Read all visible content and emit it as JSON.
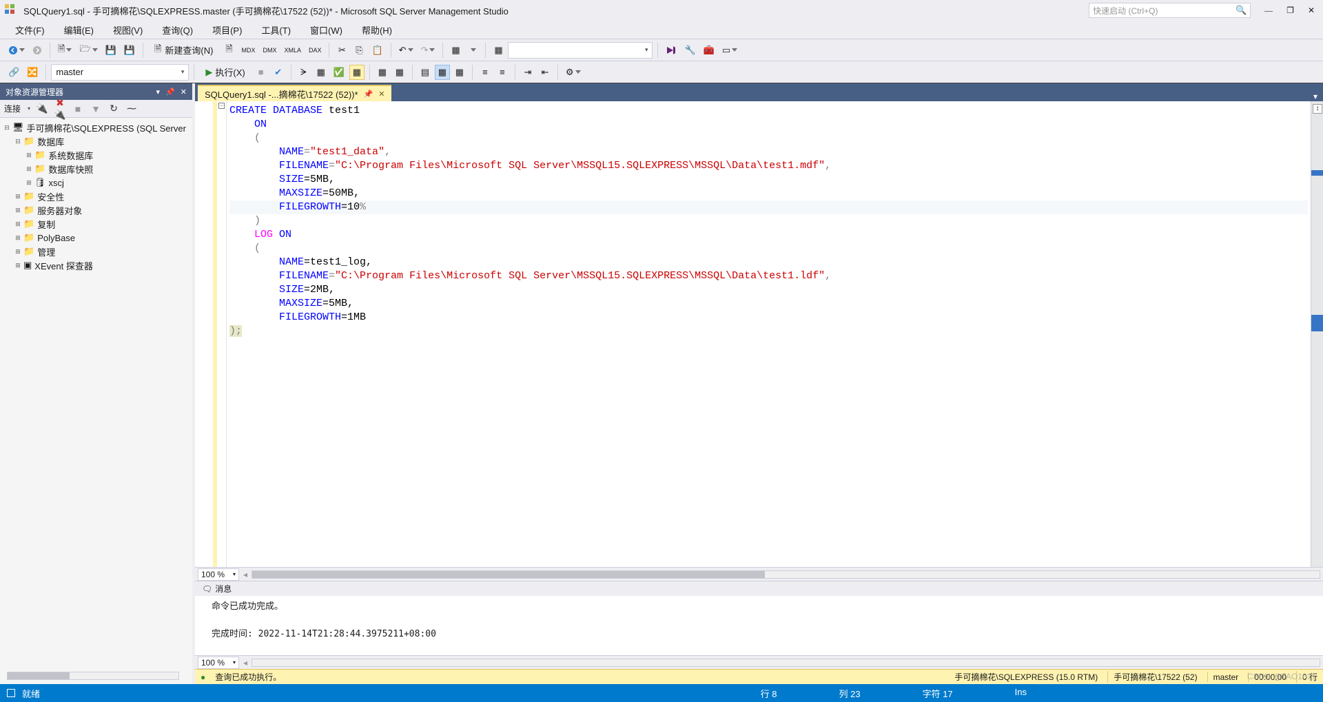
{
  "title": "SQLQuery1.sql - 手可摘棉花\\SQLEXPRESS.master (手可摘棉花\\17522 (52))* - Microsoft SQL Server Management Studio",
  "quick_launch_placeholder": "快速启动 (Ctrl+Q)",
  "menu": [
    "文件(F)",
    "编辑(E)",
    "视图(V)",
    "查询(Q)",
    "项目(P)",
    "工具(T)",
    "窗口(W)",
    "帮助(H)"
  ],
  "toolbar1": {
    "new_query": "新建查询(N)"
  },
  "toolbar2": {
    "db_combo": "master",
    "execute": "执行(X)"
  },
  "object_explorer": {
    "header": "对象资源管理器",
    "connect_label": "连接",
    "tree": {
      "server": "手可摘棉花\\SQLEXPRESS (SQL Server",
      "db_root": "数据库",
      "sys_db": "系统数据库",
      "snap": "数据库快照",
      "user_db": "xscj",
      "security": "安全性",
      "svr_obj": "服务器对象",
      "repl": "复制",
      "poly": "PolyBase",
      "mgmt": "管理",
      "xevent": "XEvent 探查器"
    }
  },
  "doc_tab": "SQLQuery1.sql -...摘棉花\\17522 (52))*",
  "code": {
    "l1_create": "CREATE",
    "l1_database": "DATABASE",
    "l1_name": " test1",
    "l2_on": "ON",
    "l3_paren": "(",
    "l4_name": "NAME",
    "l4_eq": "=",
    "l4_val": "\"test1_data\"",
    "l4_comma": ",",
    "l5_filename": "FILENAME",
    "l5_eq": "=",
    "l5_val": "\"C:\\Program Files\\Microsoft SQL Server\\MSSQL15.SQLEXPRESS\\MSSQL\\Data\\test1.mdf\"",
    "l5_comma": ",",
    "l6_size": "SIZE",
    "l6_rest": "=5MB,",
    "l7_max": "MAXSIZE",
    "l7_rest": "=50MB,",
    "l8_fg": "FILEGROWTH",
    "l8_rest": "=10",
    "l8_pct": "%",
    "l9_paren": ")",
    "l10_log": "LOG",
    "l10_on": "ON",
    "l11_paren": "(",
    "l12_name": "NAME",
    "l12_rest": "=test1_log,",
    "l13_filename": "FILENAME",
    "l13_eq": "=",
    "l13_val": "\"C:\\Program Files\\Microsoft SQL Server\\MSSQL15.SQLEXPRESS\\MSSQL\\Data\\test1.ldf\"",
    "l13_comma": ",",
    "l14_size": "SIZE",
    "l14_rest": "=2MB,",
    "l15_max": "MAXSIZE",
    "l15_rest": "=5MB,",
    "l16_fg": "FILEGROWTH",
    "l16_rest": "=1MB",
    "l17_close": ");"
  },
  "zoom": "100 %",
  "messages": {
    "tab_label": "消息",
    "line1": "命令已成功完成。",
    "line2": "完成时间: 2022-11-14T21:28:44.3975211+08:00"
  },
  "query_status": {
    "ok_text": "查询已成功执行。",
    "server": "手可摘棉花\\SQLEXPRESS (15.0 RTM)",
    "user": "手可摘棉花\\17522 (52)",
    "db": "master",
    "time": "00:00:00",
    "rows": "0 行"
  },
  "app_status": {
    "ready": "就绪",
    "line": "行 8",
    "col": "列 23",
    "char": "字符 17",
    "ins": "Ins"
  },
  "watermark": "CSDN @TAO1031"
}
